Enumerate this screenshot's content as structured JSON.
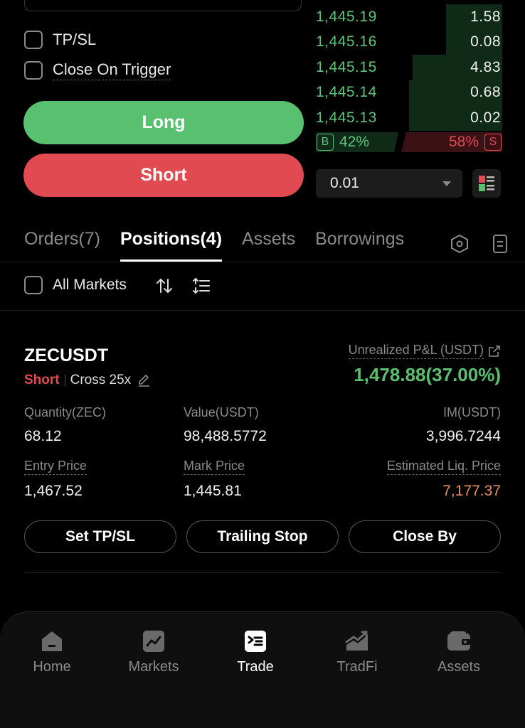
{
  "form": {
    "tpsl_label": "TP/SL",
    "close_on_trigger_label": "Close On Trigger",
    "long_label": "Long",
    "short_label": "Short"
  },
  "orderbook": {
    "bids": [
      {
        "price": "1,445.19",
        "qty": "1.58",
        "depth": 0.3
      },
      {
        "price": "1,445.16",
        "qty": "0.08",
        "depth": 0.3
      },
      {
        "price": "1,445.15",
        "qty": "4.83",
        "depth": 0.48
      },
      {
        "price": "1,445.14",
        "qty": "0.68",
        "depth": 0.5
      },
      {
        "price": "1,445.13",
        "qty": "0.02",
        "depth": 0.5
      }
    ],
    "buy_tag": "B",
    "buy_pct": "42%",
    "sell_pct": "58%",
    "sell_tag": "S",
    "step_value": "0.01",
    "colors": {
      "bid": "#5dc37a",
      "ask": "#e24a52"
    }
  },
  "tabs": [
    {
      "label": "Orders(7)",
      "active": false
    },
    {
      "label": "Positions(4)",
      "active": true
    },
    {
      "label": "Assets",
      "active": false
    },
    {
      "label": "Borrowings",
      "active": false
    }
  ],
  "tab_icons": [
    "hexagon-settings-icon",
    "document-icon"
  ],
  "filter": {
    "all_markets_label": "All Markets",
    "icons": [
      "sort-icon",
      "filter-list-icon"
    ]
  },
  "position": {
    "symbol": "ZECUSDT",
    "side": "Short",
    "margin_mode": "Cross 25x",
    "pnl_label": "Unrealized P&L (USDT)",
    "pnl_value": "1,478.88(37.00%)",
    "quantity_label": "Quantity(ZEC)",
    "quantity": "68.12",
    "value_label": "Value(USDT)",
    "value": "98,488.5772",
    "im_label": "IM(USDT)",
    "im": "3,996.7244",
    "entry_label": "Entry Price",
    "entry": "1,467.52",
    "mark_label": "Mark Price",
    "mark": "1,445.81",
    "liq_label": "Estimated Liq. Price",
    "liq": "7,177.37",
    "buttons": {
      "tpsl": "Set TP/SL",
      "trailing": "Trailing Stop",
      "close_by": "Close By"
    }
  },
  "nav": [
    {
      "label": "Home",
      "icon": "home-icon",
      "active": false
    },
    {
      "label": "Markets",
      "icon": "chart-icon",
      "active": false
    },
    {
      "label": "Trade",
      "icon": "trade-icon",
      "active": true
    },
    {
      "label": "TradFi",
      "icon": "tradfi-icon",
      "active": false
    },
    {
      "label": "Assets",
      "icon": "wallet-icon",
      "active": false
    }
  ]
}
